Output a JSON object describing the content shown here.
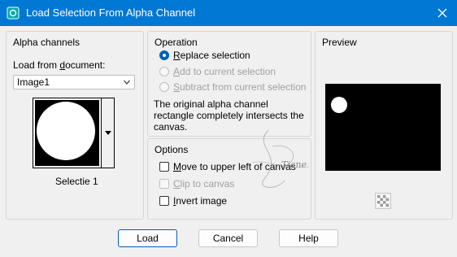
{
  "window": {
    "title": "Load Selection From Alpha Channel",
    "close_glyph": "✕"
  },
  "alpha_channels": {
    "group_label": "Alpha channels",
    "load_from_prefix": "Load from ",
    "load_from_underlined": "d",
    "load_from_suffix": "ocument:",
    "document_value": "Image1",
    "selection_name": "Selectie 1"
  },
  "operation": {
    "group_label": "Operation",
    "options": [
      {
        "pre": "",
        "u": "R",
        "post": "eplace selection",
        "selected": true,
        "enabled": true
      },
      {
        "pre": "",
        "u": "A",
        "post": "dd to current selection",
        "selected": false,
        "enabled": false
      },
      {
        "pre": "",
        "u": "S",
        "post": "ubtract from current selection",
        "selected": false,
        "enabled": false
      }
    ],
    "description": "The original alpha channel rectangle completely intersects the canvas."
  },
  "options": {
    "group_label": "Options",
    "checkboxes": [
      {
        "pre": "",
        "u": "M",
        "post": "ove to upper left of canvas",
        "checked": false,
        "enabled": true
      },
      {
        "pre": "",
        "u": "C",
        "post": "lip to canvas",
        "checked": false,
        "enabled": false
      },
      {
        "pre": "",
        "u": "I",
        "post": "nvert image",
        "checked": false,
        "enabled": true
      }
    ]
  },
  "preview": {
    "group_label": "Preview",
    "checker_icon": "checkerboard-icon"
  },
  "buttons": {
    "load": "Load",
    "cancel": "Cancel",
    "help": "Help"
  },
  "watermark": {
    "text": "Tiane"
  },
  "colors": {
    "titlebar": "#0078d4",
    "accent": "#005fb8"
  }
}
